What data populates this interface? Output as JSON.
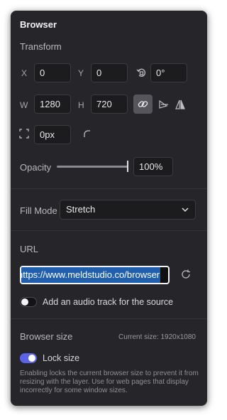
{
  "panel": {
    "title": "Browser"
  },
  "transform": {
    "label": "Transform",
    "x_label": "X",
    "x_value": "0",
    "y_label": "Y",
    "y_value": "0",
    "rotation_value": "0°",
    "w_label": "W",
    "w_value": "1280",
    "h_label": "H",
    "h_value": "720",
    "corner_radius_value": "0px"
  },
  "opacity": {
    "label": "Opacity",
    "value": "100%",
    "fraction": 1.0
  },
  "fill_mode": {
    "label": "Fill Mode",
    "selected": "Stretch"
  },
  "url": {
    "label": "URL",
    "value": "https://www.meldstudio.co/browser",
    "visible_text": "nttps://www.meldstudio.co/browser"
  },
  "audio_track": {
    "label": "Add an audio track for the source",
    "enabled": false
  },
  "browser_size": {
    "label": "Browser size",
    "current_size": "Current size: 1920x1080",
    "lock_label": "Lock size",
    "locked": true,
    "note": "Enabling locks the current browser size to prevent it from resizing with the layer. Use for web pages that display incorrectly for some window sizes."
  },
  "colors": {
    "panel_bg": "#26262a",
    "accent": "#5b63e6",
    "selection": "#1f5fae"
  }
}
